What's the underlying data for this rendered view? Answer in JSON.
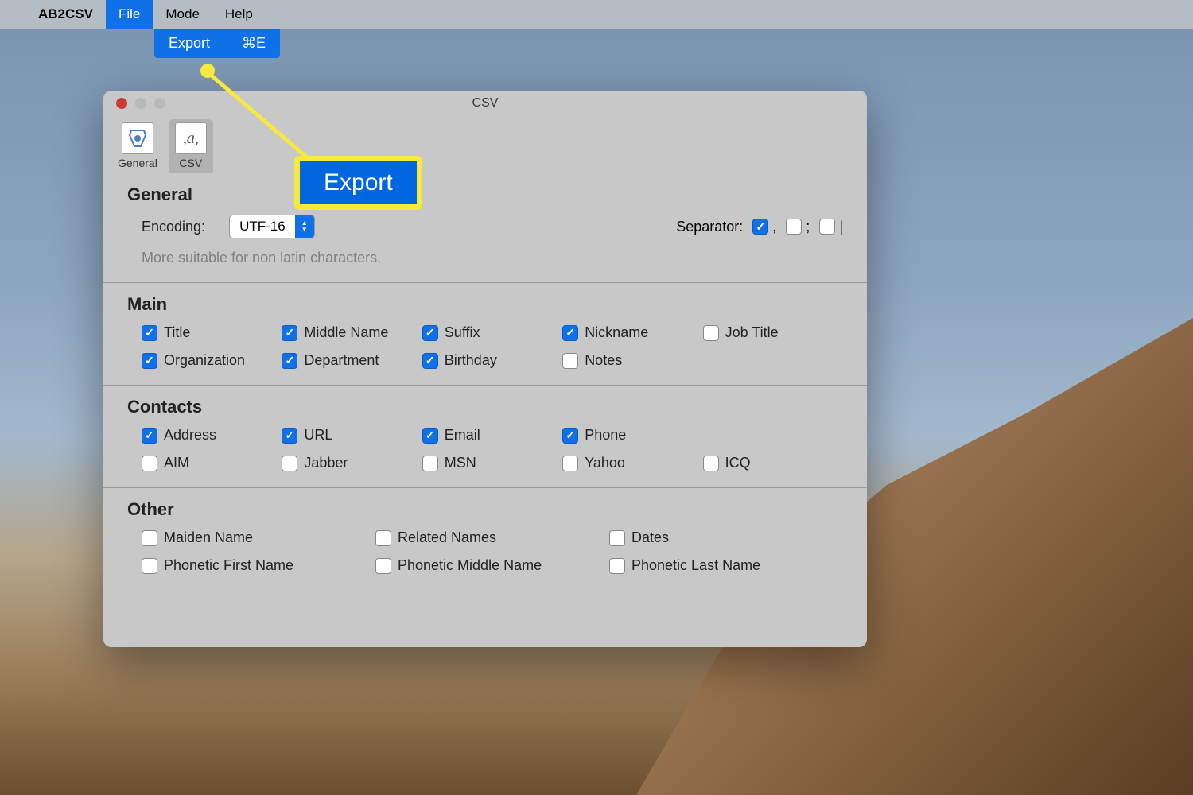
{
  "menubar": {
    "app_name": "AB2CSV",
    "items": [
      "File",
      "Mode",
      "Help"
    ],
    "active_index": 0
  },
  "dropdown": {
    "label": "Export",
    "shortcut": "⌘E"
  },
  "annotation": {
    "callout": "Export"
  },
  "window": {
    "title": "CSV",
    "toolbar": [
      {
        "label": "General",
        "icon_name": "general-icon",
        "glyph": "⚙",
        "selected": false
      },
      {
        "label": "CSV",
        "icon_name": "csv-icon",
        "glyph": ",a,",
        "selected": true
      }
    ],
    "sections": {
      "general": {
        "title": "General",
        "encoding_label": "Encoding:",
        "encoding_value": "UTF-16",
        "separator_label": "Separator:",
        "separators": [
          {
            "symbol": ",",
            "checked": true
          },
          {
            "symbol": ";",
            "checked": false
          },
          {
            "symbol": "|",
            "checked": false
          }
        ],
        "hint": "More suitable for non latin characters."
      },
      "main": {
        "title": "Main",
        "items": [
          {
            "label": "Title",
            "checked": true
          },
          {
            "label": "Middle Name",
            "checked": true
          },
          {
            "label": "Suffix",
            "checked": true
          },
          {
            "label": "Nickname",
            "checked": true
          },
          {
            "label": "Job Title",
            "checked": false
          },
          {
            "label": "Organization",
            "checked": true
          },
          {
            "label": "Department",
            "checked": true
          },
          {
            "label": "Birthday",
            "checked": true
          },
          {
            "label": "Notes",
            "checked": false
          }
        ]
      },
      "contacts": {
        "title": "Contacts",
        "items": [
          {
            "label": "Address",
            "checked": true
          },
          {
            "label": "URL",
            "checked": true
          },
          {
            "label": "Email",
            "checked": true
          },
          {
            "label": "Phone",
            "checked": true
          },
          {
            "label": "",
            "checked": false,
            "empty": true
          },
          {
            "label": "AIM",
            "checked": false
          },
          {
            "label": "Jabber",
            "checked": false
          },
          {
            "label": "MSN",
            "checked": false
          },
          {
            "label": "Yahoo",
            "checked": false
          },
          {
            "label": "ICQ",
            "checked": false
          }
        ]
      },
      "other": {
        "title": "Other",
        "items": [
          {
            "label": "Maiden Name",
            "checked": false
          },
          {
            "label": "Related Names",
            "checked": false
          },
          {
            "label": "Dates",
            "checked": false
          },
          {
            "label": "Phonetic First Name",
            "checked": false
          },
          {
            "label": "Phonetic Middle Name",
            "checked": false
          },
          {
            "label": "Phonetic Last Name",
            "checked": false
          }
        ]
      }
    }
  }
}
